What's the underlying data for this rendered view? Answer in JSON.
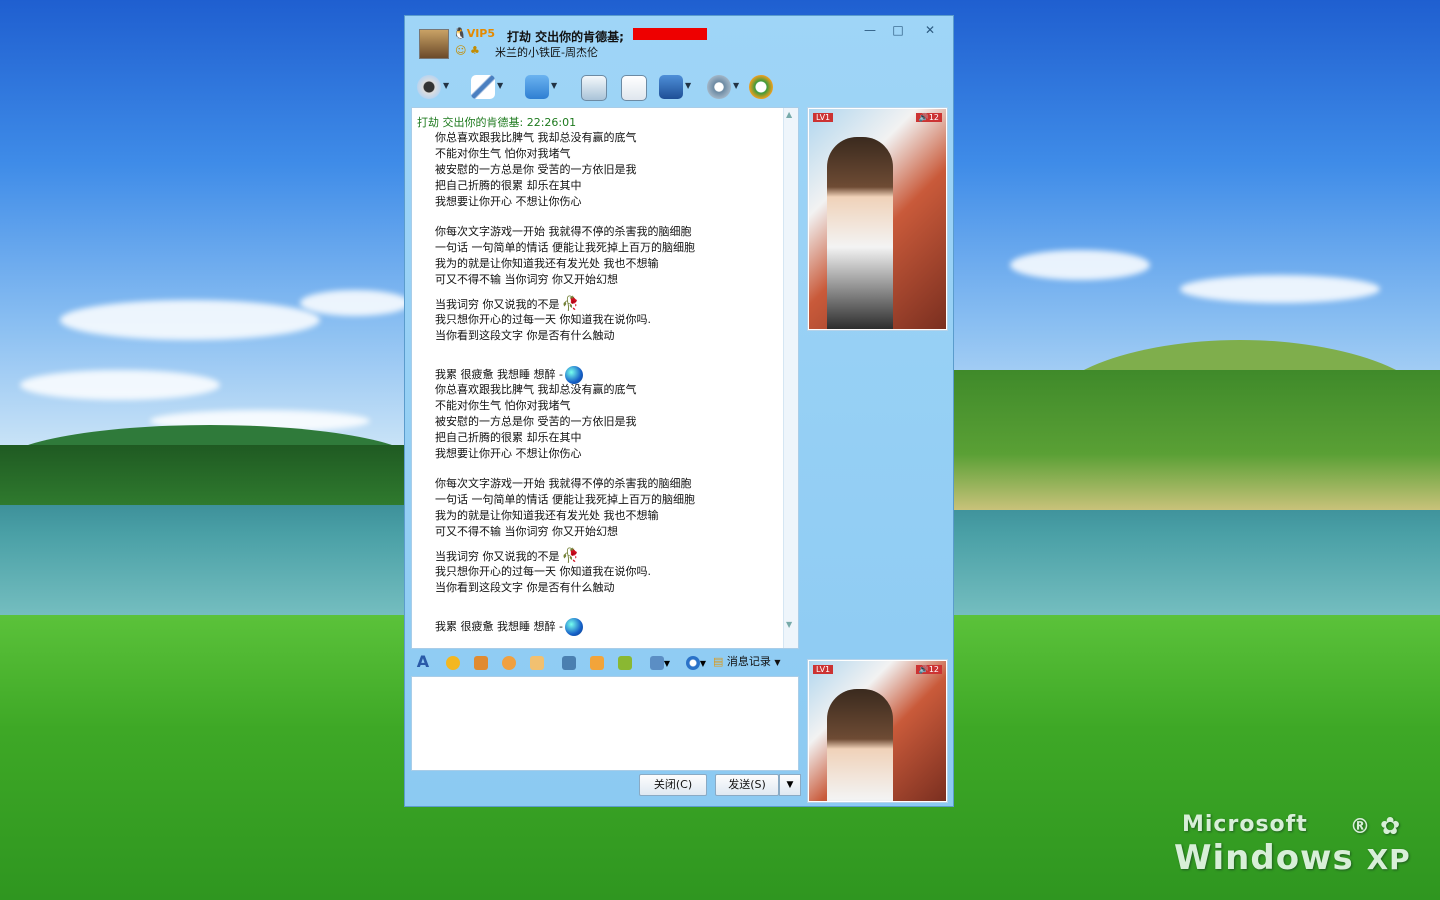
{
  "window": {
    "contact_name": "打劫 交出你的肯德基;",
    "vip_label": "VIP5",
    "signature": "米兰的小铁匠-周杰伦",
    "controls": {
      "minimize": "—",
      "maximize": "□",
      "close": "✕"
    }
  },
  "toolbar": {
    "items": [
      "video-call",
      "voice-call",
      "send-file",
      "send-sms",
      "create-group",
      "apps",
      "settings",
      "soso"
    ]
  },
  "chat": {
    "header": "打劫 交出你的肯德基:  22:26:01",
    "lines": [
      "你总喜欢跟我比脾气 我却总没有赢的底气",
      "不能对你生气 怕你对我堵气",
      "被安慰的一方总是你 受苦的一方依旧是我",
      "把自己折腾的很累 却乐在其中",
      "我想要让你开心 不想让你伤心",
      "",
      "你每次文字游戏一开始 我就得不停的杀害我的脑细胞",
      "一句话 一句简单的情话 便能让我死掉上百万的脑细胞",
      "我为的就是让你知道我还有发光处 我也不想输",
      "可又不得不输 当你词穷 你又开始幻想",
      "当我词穷 你又说我的不是",
      "我只想你开心的过每一天  你知道我在说你吗.",
      "当你看到这段文字 你是否有什么触动",
      "",
      "我累 很疲惫 我想睡 想醉 -",
      "你总喜欢跟我比脾气 我却总没有赢的底气",
      "不能对你生气 怕你对我堵气",
      "被安慰的一方总是你 受苦的一方依旧是我",
      "把自己折腾的很累 却乐在其中",
      "我想要让你开心 不想让你伤心",
      "",
      "你每次文字游戏一开始 我就得不停的杀害我的脑细胞",
      "一句话 一句简单的情话 便能让我死掉上百万的脑细胞",
      "我为的就是让你知道我还有发光处 我也不想输",
      "可又不得不输 当你词穷 你又开始幻想",
      "当我词穷 你又说我的不是",
      "我只想你开心的过每一天  你知道我在说你吗.",
      "当你看到这段文字 你是否有什么触动",
      "",
      "我累 很疲惫 我想睡 想醉 -"
    ]
  },
  "side": {
    "badge": "LV1",
    "volume": "12"
  },
  "format_bar": {
    "font_label": "A",
    "history_label": "消息记录"
  },
  "buttons": {
    "close_label": "关闭(C)",
    "send_label": "发送(S)"
  },
  "desktop": {
    "brand_top": "Microsoft",
    "brand_bottom": "Windows",
    "brand_xp": "XP"
  },
  "colors": {
    "window_bg": "#9fd5f7",
    "chat_header": "#1e7a1e",
    "redaction": "#ee0000"
  }
}
